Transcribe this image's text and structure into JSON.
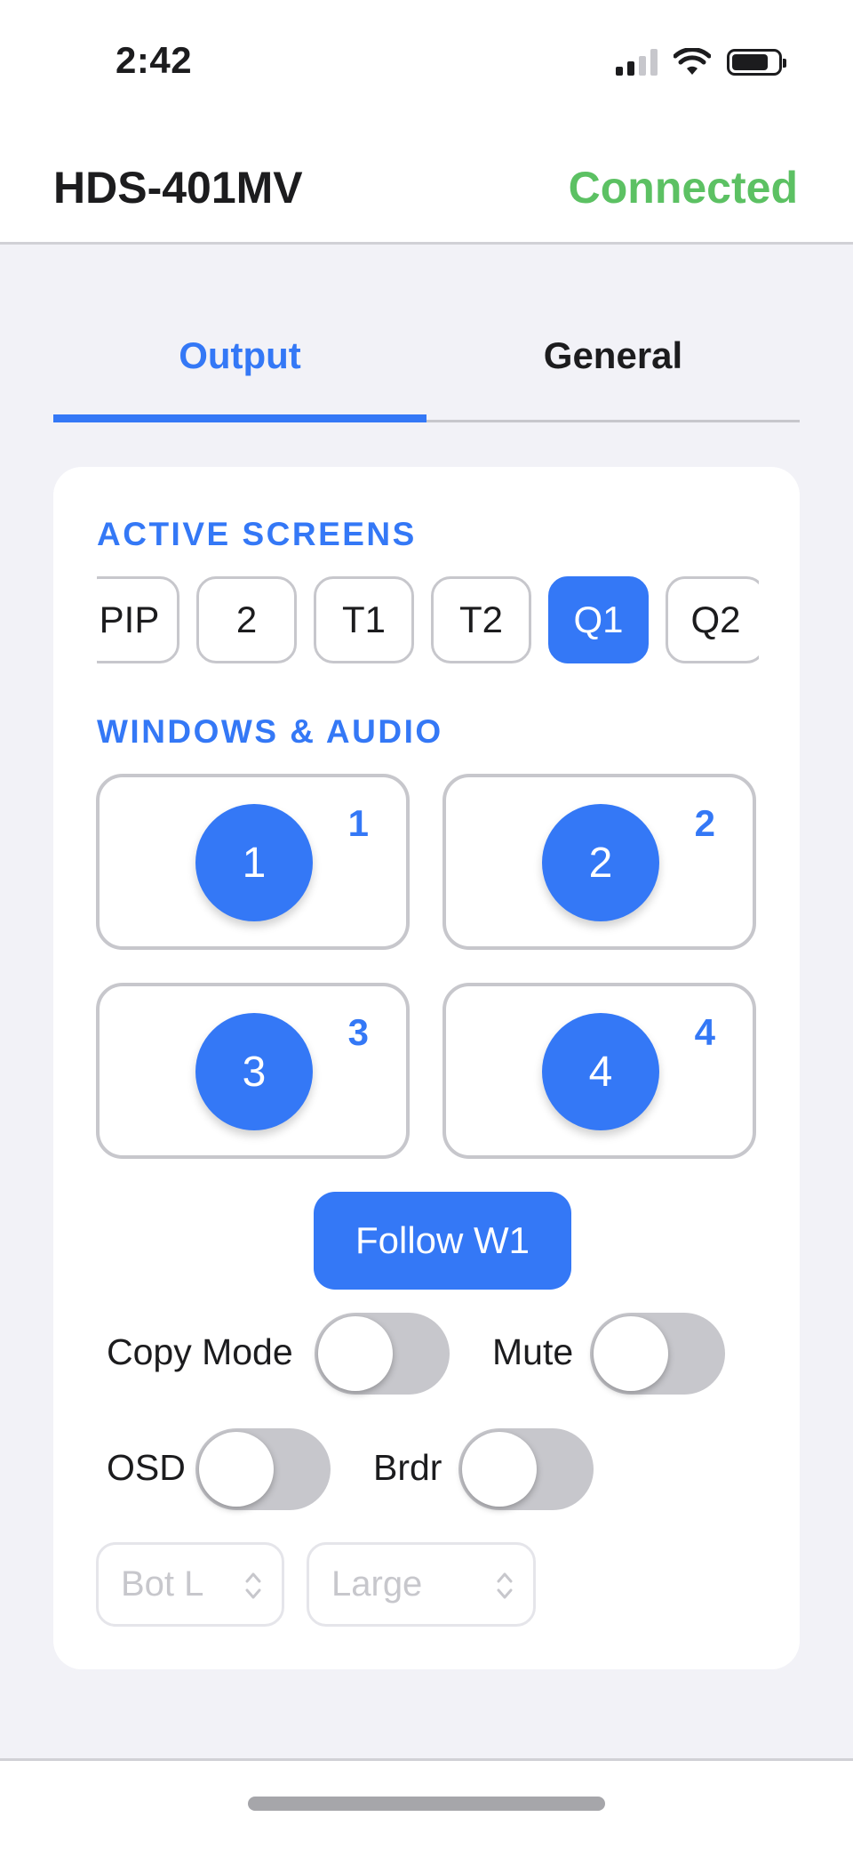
{
  "status_bar": {
    "time": "2:42",
    "icons": [
      "cellular-signal-icon",
      "wifi-icon",
      "battery-icon"
    ]
  },
  "header": {
    "device_name": "HDS-401MV",
    "connection_status": "Connected"
  },
  "tabs": [
    {
      "label": "Output",
      "active": true
    },
    {
      "label": "General",
      "active": false
    }
  ],
  "active_screens": {
    "label": "ACTIVE SCREENS",
    "options": [
      "PIP",
      "2",
      "T1",
      "T2",
      "Q1",
      "Q2"
    ],
    "selected": "Q1"
  },
  "windows_audio": {
    "label": "WINDOWS & AUDIO",
    "windows": [
      {
        "window": "1",
        "audio": "1"
      },
      {
        "window": "2",
        "audio": "2"
      },
      {
        "window": "3",
        "audio": "3"
      },
      {
        "window": "4",
        "audio": "4"
      }
    ]
  },
  "follow_button": {
    "label": "Follow W1"
  },
  "toggles": {
    "copy_mode": {
      "label": "Copy Mode",
      "on": false
    },
    "mute": {
      "label": "Mute",
      "on": false
    },
    "osd": {
      "label": "OSD",
      "on": false
    },
    "border": {
      "label": "Brdr",
      "on": false
    }
  },
  "selects": {
    "position": {
      "value": "Bot L",
      "disabled": true
    },
    "size": {
      "value": "Large",
      "disabled": true
    }
  },
  "colors": {
    "accent": "#3478f6",
    "connected": "#5cc163",
    "switch_off": "#c7c7cc",
    "background": "#f2f2f7"
  }
}
